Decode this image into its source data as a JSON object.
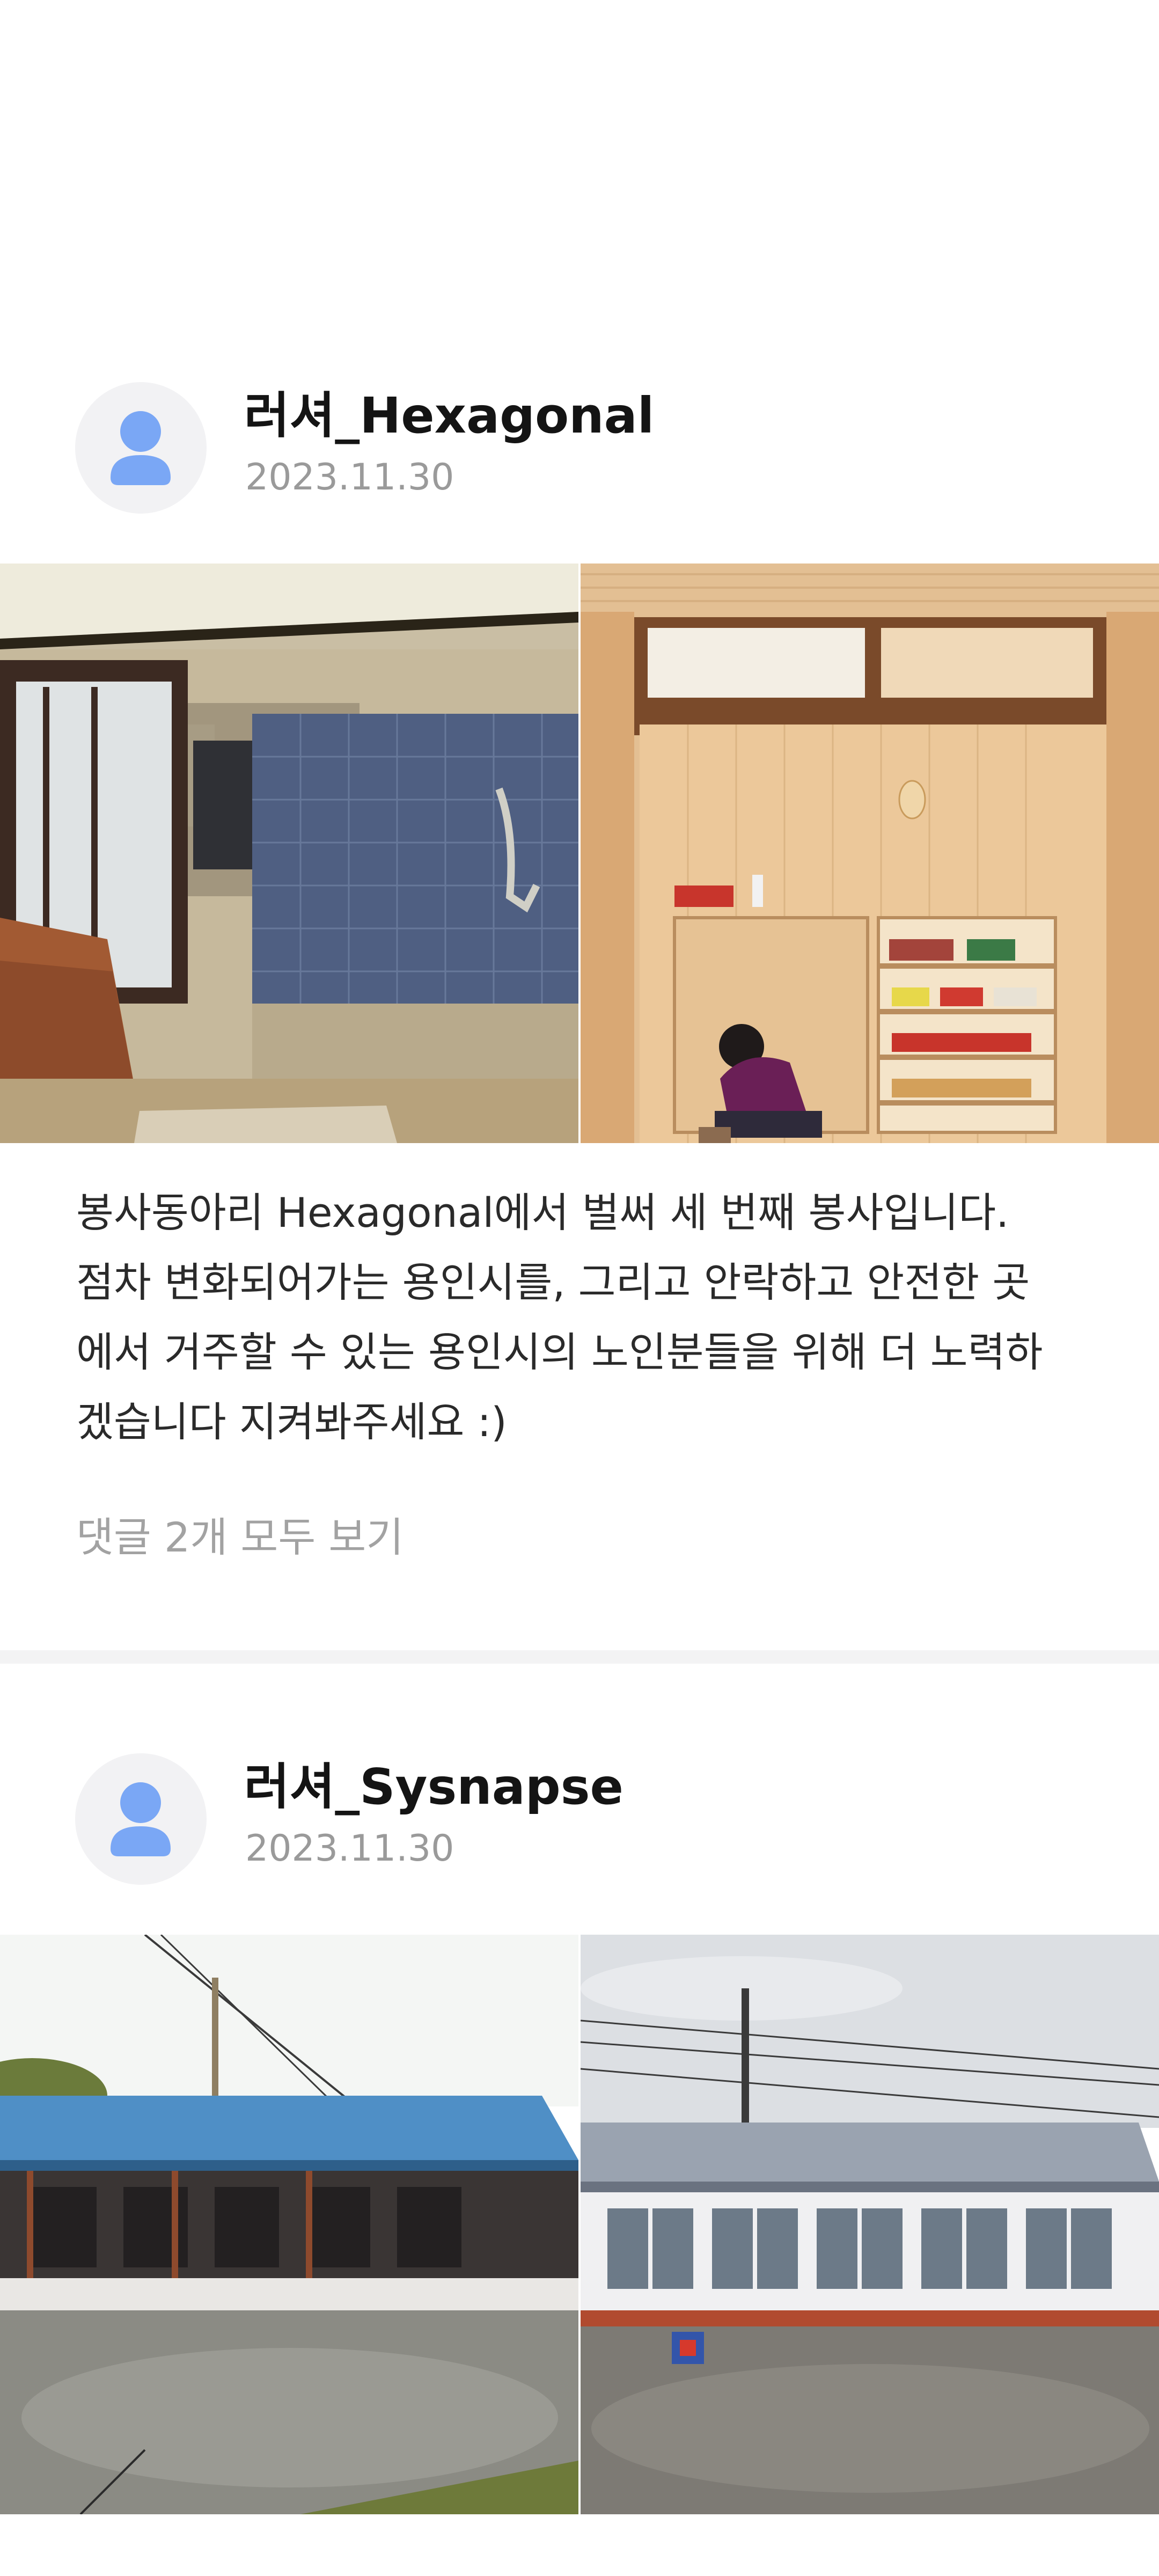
{
  "feed": {
    "posts": [
      {
        "author": "러셔_Hexagonal",
        "date": "2023.11.30",
        "photos": [
          {
            "icon": "interior-before-renovation-photo"
          },
          {
            "icon": "interior-after-renovation-photo"
          }
        ],
        "body_lines": [
          "봉사동아리 Hexagonal에서 벌써 세 번째 봉사입니다.",
          "점차 변화되어가는 용인시를, 그리고 안락하고 안전한 곳",
          "에서 거주할 수 있는 용인시의 노인분들을 위해 더 노력하",
          "겠습니다 지켜봐주세요 :)"
        ],
        "comments_link": "댓글 2개 모두 보기"
      },
      {
        "author": "러셔_Sysnapse",
        "date": "2023.11.30",
        "photos": [
          {
            "icon": "house-exterior-before-photo"
          },
          {
            "icon": "house-exterior-after-photo"
          }
        ]
      }
    ]
  },
  "colors": {
    "background": "#ffffff",
    "divider": "#f3f3f4",
    "avatar_bg": "#f2f2f4",
    "avatar_icon": "#7aa7f5",
    "author_text": "#141414",
    "meta_text": "#9a9a9a",
    "body_text": "#2a2a2a"
  }
}
